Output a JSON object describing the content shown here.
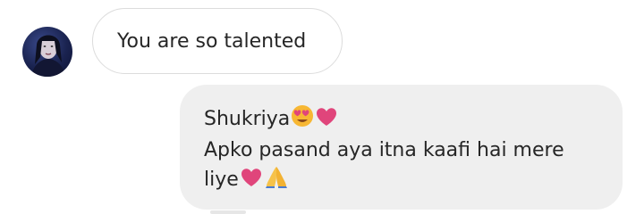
{
  "incoming": {
    "avatar_icon": "profile-avatar-icon",
    "text": "You are so talented"
  },
  "outgoing": {
    "line1": "Shukriya",
    "line1_emojis": [
      "heart-eyes-emoji",
      "heart-emoji"
    ],
    "line2": "Apko pasand aya itna kaafi hai mere",
    "line3": "liye",
    "line3_emojis": [
      "heart-emoji",
      "folded-hands-emoji"
    ]
  },
  "colors": {
    "incoming_bg": "#ffffff",
    "incoming_border": "#dcdcdc",
    "outgoing_bg": "#efefef",
    "text": "#262626",
    "heart": "#e0457b",
    "heart_eyes_face": "#f7b733"
  }
}
